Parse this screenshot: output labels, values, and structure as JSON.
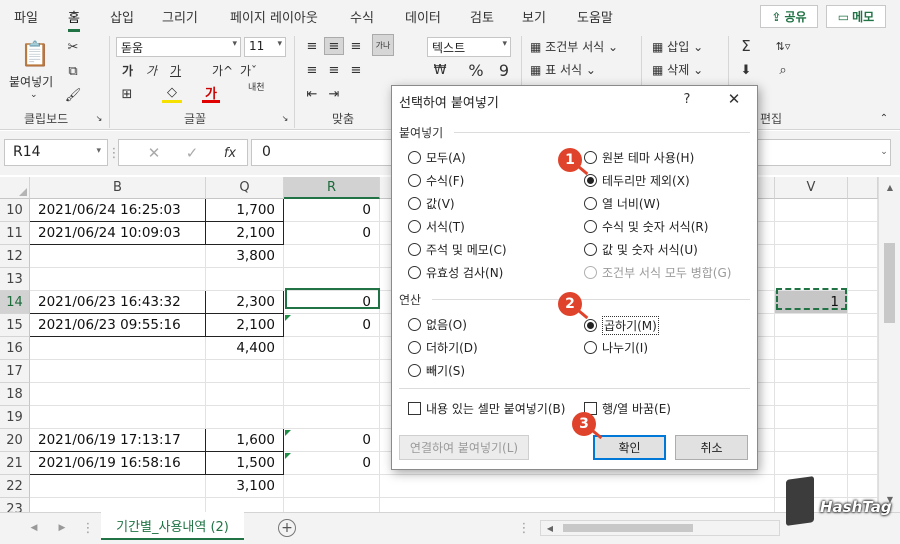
{
  "ribbon_tabs": [
    "파일",
    "홈",
    "삽입",
    "그리기",
    "페이지 레이아웃",
    "수식",
    "데이터",
    "검토",
    "보기",
    "도움말"
  ],
  "share_label": "공유",
  "memo_label": "메모",
  "clipboard": {
    "paste_label": "붙여넣기",
    "group": "클립보드"
  },
  "font": {
    "name": "돋움",
    "size": "11",
    "group": "글꼴",
    "bold": "가",
    "italic": "가",
    "underline": "가",
    "grow": "가^",
    "shrink": "가ˇ",
    "phonetic": "내천"
  },
  "align": {
    "group": "맞춤"
  },
  "number": {
    "format": "텍스트"
  },
  "styles": {
    "conditional": "조건부 서식",
    "table": "표 서식"
  },
  "cells": {
    "insert": "삽입",
    "delete": "삭제"
  },
  "editing": {
    "group": "편집"
  },
  "formula_bar": {
    "cell_ref": "R14",
    "value": "0",
    "fx": "fx"
  },
  "columns": [
    "B",
    "Q",
    "R",
    "V"
  ],
  "rows": [
    {
      "num": "10",
      "b": "2021/06/24 16:25:03",
      "q": "1,700",
      "r": "0",
      "v": ""
    },
    {
      "num": "11",
      "b": "2021/06/24 10:09:03",
      "q": "2,100",
      "r": "0",
      "v": ""
    },
    {
      "num": "12",
      "b": "",
      "q": "3,800",
      "r": "",
      "v": ""
    },
    {
      "num": "13",
      "b": "",
      "q": "",
      "r": "",
      "v": ""
    },
    {
      "num": "14",
      "b": "2021/06/23 16:43:32",
      "q": "2,300",
      "r": "0",
      "v": "1"
    },
    {
      "num": "15",
      "b": "2021/06/23 09:55:16",
      "q": "2,100",
      "r": "0",
      "v": ""
    },
    {
      "num": "16",
      "b": "",
      "q": "4,400",
      "r": "",
      "v": ""
    },
    {
      "num": "17",
      "b": "",
      "q": "",
      "r": "",
      "v": ""
    },
    {
      "num": "18",
      "b": "",
      "q": "",
      "r": "",
      "v": ""
    },
    {
      "num": "19",
      "b": "",
      "q": "",
      "r": "",
      "v": ""
    },
    {
      "num": "20",
      "b": "2021/06/19 17:13:17",
      "q": "1,600",
      "r": "0",
      "v": ""
    },
    {
      "num": "21",
      "b": "2021/06/19 16:58:16",
      "q": "1,500",
      "r": "0",
      "v": ""
    },
    {
      "num": "22",
      "b": "",
      "q": "3,100",
      "r": "",
      "v": ""
    },
    {
      "num": "23",
      "b": "",
      "q": "",
      "r": "",
      "v": ""
    }
  ],
  "sheet_tab": "기간별_사용내역 (2)",
  "dialog": {
    "title": "선택하여 붙여넣기",
    "help": "?",
    "close": "✕",
    "paste_section": "붙여넣기",
    "paste_left": [
      "모두(A)",
      "수식(F)",
      "값(V)",
      "서식(T)",
      "주석 및 메모(C)",
      "유효성 검사(N)"
    ],
    "paste_right": [
      "원본 테마 사용(H)",
      "테두리만 제외(X)",
      "열 너비(W)",
      "수식 및 숫자 서식(R)",
      "값 및 숫자 서식(U)",
      "조건부 서식 모두 병합(G)"
    ],
    "op_section": "연산",
    "op_left": [
      "없음(O)",
      "더하기(D)",
      "빼기(S)"
    ],
    "op_right": [
      "곱하기(M)",
      "나누기(I)"
    ],
    "skip_blanks": "내용 있는 셀만 붙여넣기(B)",
    "transpose": "행/열 바꿈(E)",
    "paste_link": "연결하여 붙여넣기(L)",
    "ok": "확인",
    "cancel": "취소"
  },
  "badges": [
    "1",
    "2",
    "3"
  ],
  "watermark": "HashTag",
  "colors": {
    "accent": "#217346",
    "badge": "#e0432b",
    "dialog_focus": "#0078d7"
  }
}
